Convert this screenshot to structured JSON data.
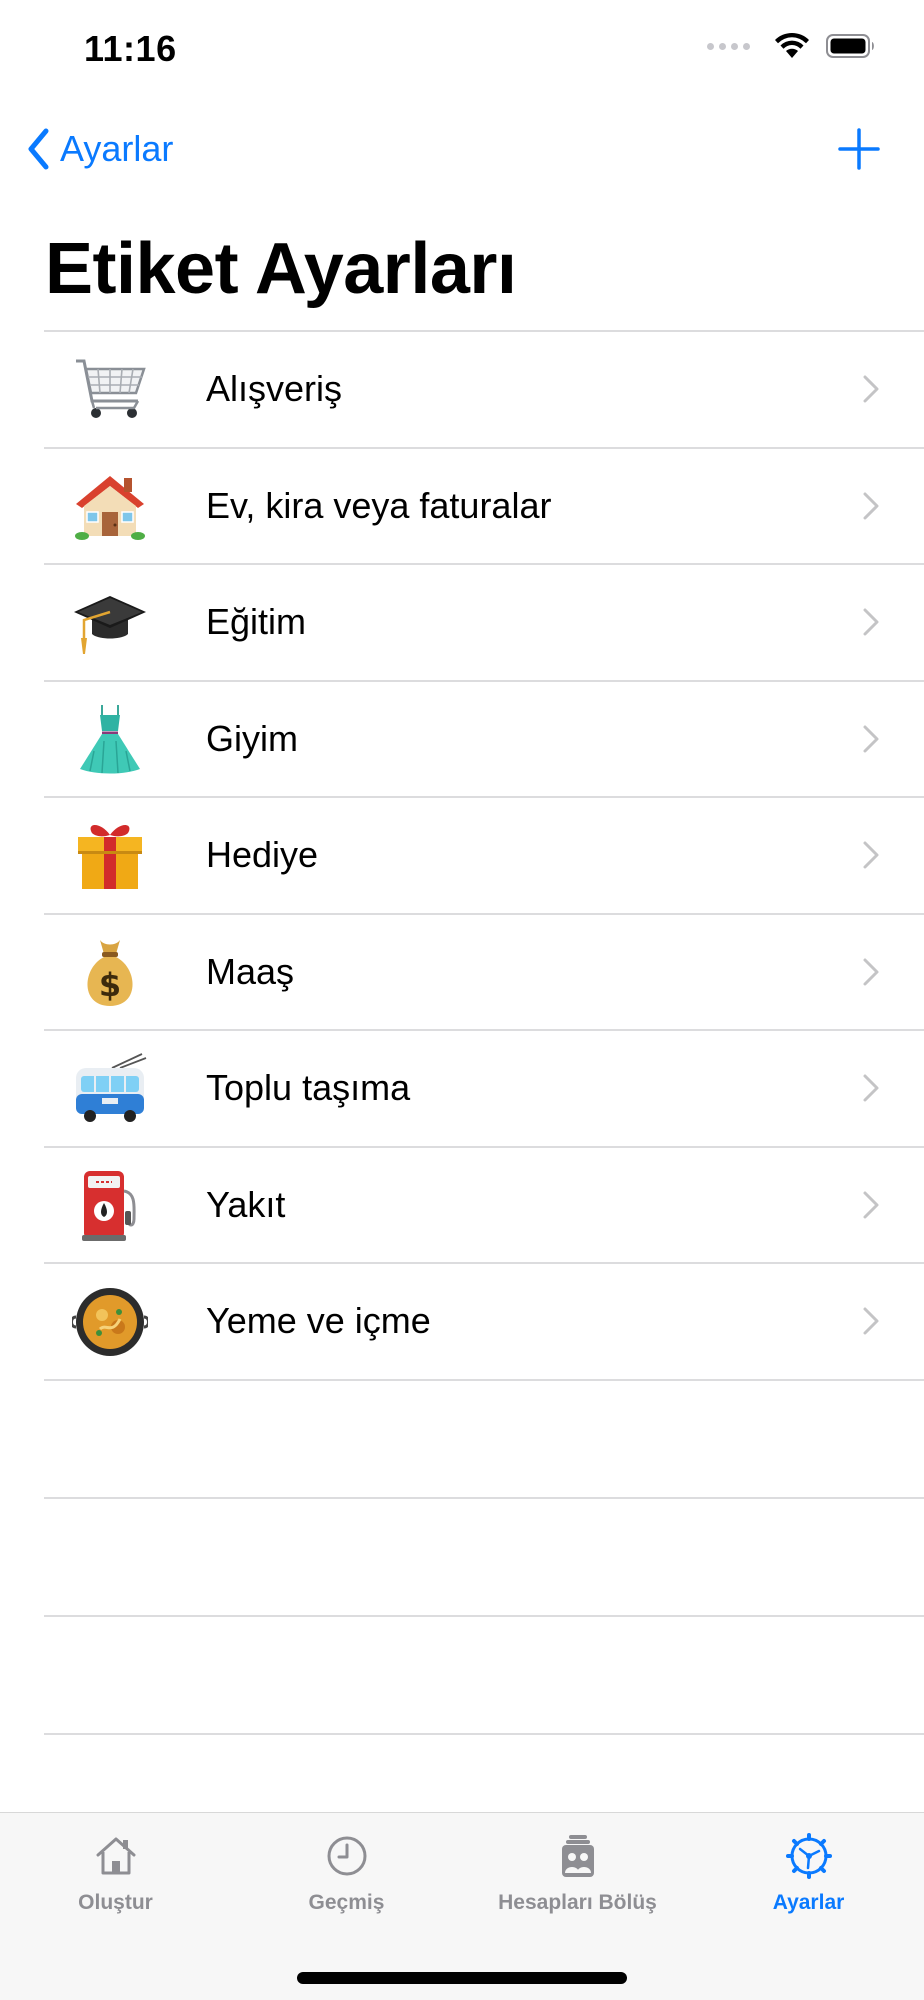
{
  "status": {
    "time": "11:16"
  },
  "nav": {
    "back_label": "Ayarlar"
  },
  "title": "Etiket Ayarları",
  "tags": [
    {
      "label": "Alışveriş",
      "icon": "shopping-cart-icon"
    },
    {
      "label": "Ev, kira veya faturalar",
      "icon": "house-icon"
    },
    {
      "label": "Eğitim",
      "icon": "graduation-cap-icon"
    },
    {
      "label": "Giyim",
      "icon": "dress-icon"
    },
    {
      "label": "Hediye",
      "icon": "gift-icon"
    },
    {
      "label": "Maaş",
      "icon": "money-bag-icon"
    },
    {
      "label": "Toplu taşıma",
      "icon": "trolleybus-icon"
    },
    {
      "label": "Yakıt",
      "icon": "fuel-pump-icon"
    },
    {
      "label": "Yeme ve içme",
      "icon": "paella-icon"
    }
  ],
  "tabs": [
    {
      "label": "Oluştur",
      "icon": "home-icon",
      "active": false
    },
    {
      "label": "Geçmiş",
      "icon": "clock-icon",
      "active": false
    },
    {
      "label": "Hesapları Bölüş",
      "icon": "people-card-icon",
      "active": false
    },
    {
      "label": "Ayarlar",
      "icon": "settings-gear-icon",
      "active": true
    }
  ],
  "colors": {
    "accent": "#0a7aff",
    "inactive": "#8e8e93",
    "separator": "#dcdcde"
  }
}
